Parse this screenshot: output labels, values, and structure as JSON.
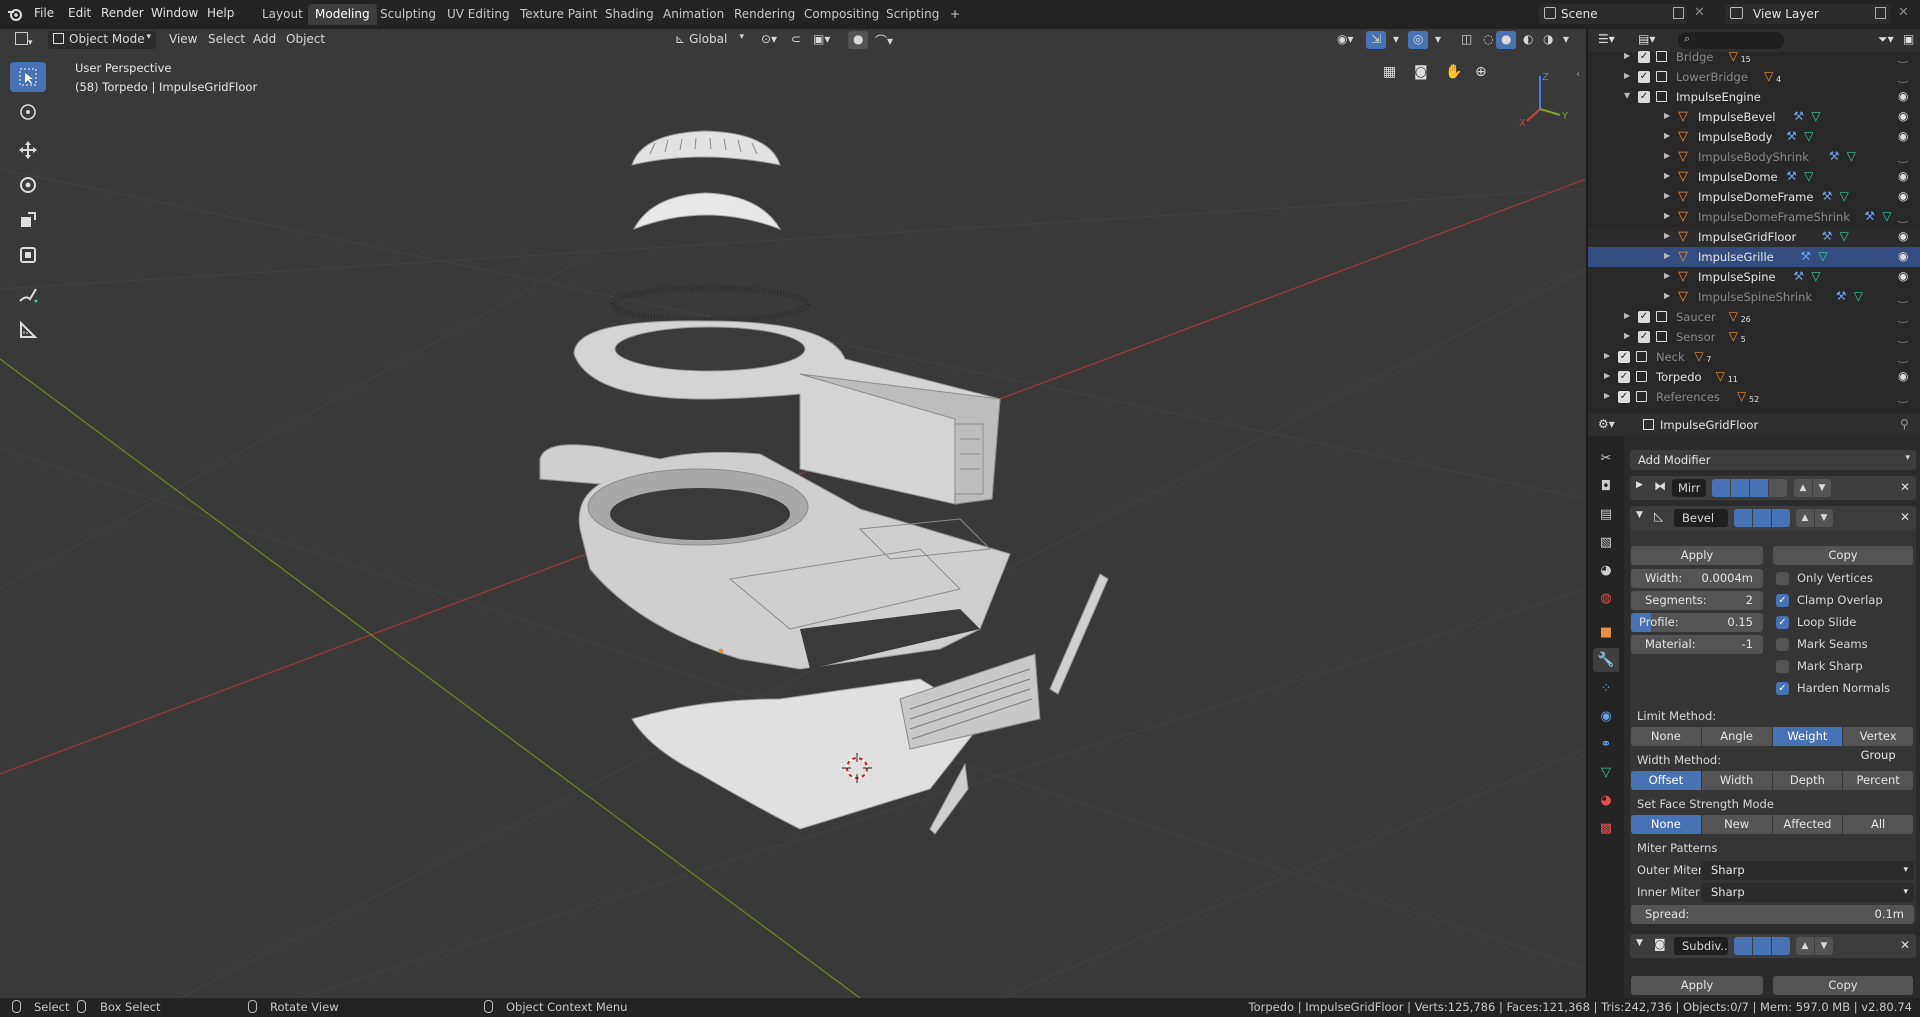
{
  "topbar": {
    "menus": [
      "File",
      "Edit",
      "Render",
      "Window",
      "Help"
    ],
    "workspaces": [
      "Layout",
      "Modeling",
      "Sculpting",
      "UV Editing",
      "Texture Paint",
      "Shading",
      "Animation",
      "Rendering",
      "Compositing",
      "Scripting"
    ],
    "active_workspace": "Modeling",
    "add_tab": "+",
    "scene_name": "Scene",
    "view_layer": "View Layer"
  },
  "viewport": {
    "mode": "Object Mode",
    "menus": [
      "View",
      "Select",
      "Add",
      "Object"
    ],
    "transform_orientation": "Global",
    "perspective_label": "User Perspective",
    "object_label": "(58) Torpedo | ImpulseGridFloor",
    "axes": {
      "x": "X",
      "y": "Y",
      "z": "Z"
    }
  },
  "tools": [
    "select-box",
    "cursor",
    "move",
    "rotate",
    "scale",
    "transform",
    "annotate",
    "measure"
  ],
  "outliner": {
    "search_placeholder": "",
    "rows": [
      {
        "name": "Bridge",
        "count": "15",
        "indent": 1,
        "dim": true,
        "check": true,
        "eye": false
      },
      {
        "name": "LowerBridge",
        "count": "4",
        "indent": 1,
        "dim": true,
        "check": true,
        "eye": false
      },
      {
        "name": "ImpulseEngine",
        "count": "",
        "indent": 1,
        "dim": false,
        "check": true,
        "eye": true,
        "expanded": true
      },
      {
        "name": "ImpulseBevel",
        "count": "",
        "indent": 2,
        "dim": false,
        "check": false,
        "eye": true,
        "obj": true
      },
      {
        "name": "ImpulseBody",
        "count": "",
        "indent": 2,
        "dim": false,
        "check": false,
        "eye": true,
        "obj": true
      },
      {
        "name": "ImpulseBodyShrink",
        "count": "",
        "indent": 2,
        "dim": true,
        "check": false,
        "eye": false,
        "obj": true
      },
      {
        "name": "ImpulseDome",
        "count": "",
        "indent": 2,
        "dim": false,
        "check": false,
        "eye": true,
        "obj": true
      },
      {
        "name": "ImpulseDomeFrame",
        "count": "",
        "indent": 2,
        "dim": false,
        "check": false,
        "eye": true,
        "obj": true
      },
      {
        "name": "ImpulseDomeFrameShrink",
        "count": "",
        "indent": 2,
        "dim": true,
        "check": false,
        "eye": false,
        "obj": true
      },
      {
        "name": "ImpulseGridFloor",
        "count": "",
        "indent": 2,
        "dim": false,
        "check": false,
        "eye": true,
        "obj": true,
        "alt": true
      },
      {
        "name": "ImpulseGrille",
        "count": "",
        "indent": 2,
        "dim": false,
        "check": false,
        "eye": true,
        "obj": true,
        "selected": true
      },
      {
        "name": "ImpulseSpine",
        "count": "",
        "indent": 2,
        "dim": false,
        "check": false,
        "eye": true,
        "obj": true
      },
      {
        "name": "ImpulseSpineShrink",
        "count": "",
        "indent": 2,
        "dim": true,
        "check": false,
        "eye": false,
        "obj": true
      },
      {
        "name": "Saucer",
        "count": "26",
        "indent": 1,
        "dim": true,
        "check": true,
        "eye": false
      },
      {
        "name": "Sensor",
        "count": "5",
        "indent": 1,
        "dim": true,
        "check": true,
        "eye": false
      },
      {
        "name": "Neck",
        "count": "7",
        "indent": 0,
        "dim": true,
        "check": true,
        "eye": false
      },
      {
        "name": "Torpedo",
        "count": "11",
        "indent": 0,
        "dim": false,
        "check": true,
        "eye": true
      },
      {
        "name": "References",
        "count": "52",
        "indent": 0,
        "dim": true,
        "check": true,
        "eye": false
      }
    ]
  },
  "properties": {
    "object_name": "ImpulseGridFloor",
    "add_modifier": "Add Modifier",
    "mod_mirror": "Mirr",
    "mod_bevel": "Bevel",
    "apply": "Apply",
    "copy": "Copy",
    "width_label": "Width:",
    "width_value": "0.0004m",
    "segments_label": "Segments:",
    "segments_value": "2",
    "profile_label": "Profile:",
    "profile_value": "0.15",
    "profile_fraction": 0.15,
    "material_label": "Material:",
    "material_value": "-1",
    "checks": [
      {
        "label": "Only Vertices",
        "on": false
      },
      {
        "label": "Clamp Overlap",
        "on": true
      },
      {
        "label": "Loop Slide",
        "on": true
      },
      {
        "label": "Mark Seams",
        "on": false
      },
      {
        "label": "Mark Sharp",
        "on": false
      },
      {
        "label": "Harden Normals",
        "on": true
      }
    ],
    "limit_method_label": "Limit Method:",
    "limit_methods": [
      "None",
      "Angle",
      "Weight",
      "Vertex Group"
    ],
    "limit_active": "Weight",
    "width_method_label": "Width Method:",
    "width_methods": [
      "Offset",
      "Width",
      "Depth",
      "Percent"
    ],
    "width_active": "Offset",
    "face_strength_label": "Set Face Strength Mode",
    "face_modes": [
      "None",
      "New",
      "Affected",
      "All"
    ],
    "face_active": "None",
    "miter_label": "Miter Patterns",
    "outer_miter_label": "Outer Miter:",
    "outer_miter_value": "Sharp",
    "inner_miter_label": "Inner Miter:",
    "inner_miter_value": "Sharp",
    "spread_label": "Spread:",
    "spread_value": "0.1m",
    "mod_subdiv": "Subdiv..."
  },
  "statusbar": {
    "select": "Select",
    "box_select": "Box Select",
    "rotate_view": "Rotate View",
    "context_menu": "Object Context Menu",
    "stats": "Torpedo | ImpulseGridFloor | Verts:125,786 | Faces:121,368 | Tris:242,736 | Objects:0/7 | Mem: 597.0 MB | v2.80.74"
  },
  "colors": {
    "accent": "#4772b3",
    "object_orange": "#e8913a",
    "mesh_green": "#3fc9a0",
    "wrench_blue": "#6ca2e8",
    "x_axis": "#c94444",
    "y_axis": "#7fa32c"
  }
}
